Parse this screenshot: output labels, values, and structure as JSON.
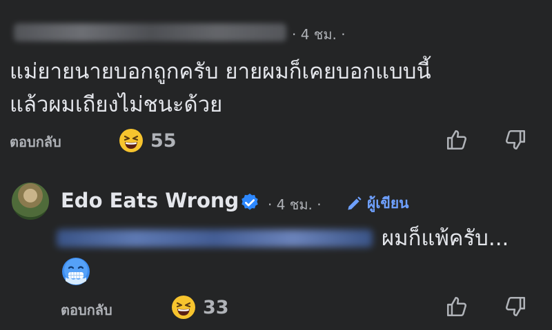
{
  "comment1": {
    "time": "· 4 ชม. ·",
    "text_line1": "แม่ยายนายบอกถูกครับ ยายผมก็เคยบอกแบบนี้",
    "text_line2": "แล้วผมเถียงไม่ชนะด้วย",
    "reply_label": "ตอบกลับ",
    "reaction_count": "55",
    "reaction_icon": "grinning-squinting-face-icon"
  },
  "comment2": {
    "author": "Edo Eats Wrong",
    "time": "· 4 ชม. ·",
    "author_badge": "ผู้เขียน",
    "text": "ผมก็แพ้ครับ...",
    "emoji": "cold-face-icon",
    "reply_label": "ตอบกลับ",
    "reaction_count": "33",
    "reaction_icon": "grinning-squinting-face-icon"
  },
  "colors": {
    "background": "#242526",
    "text": "#e4e6eb",
    "muted": "#b0b3b8",
    "accent": "#6ea0ff",
    "verified": "#2d88ff"
  }
}
